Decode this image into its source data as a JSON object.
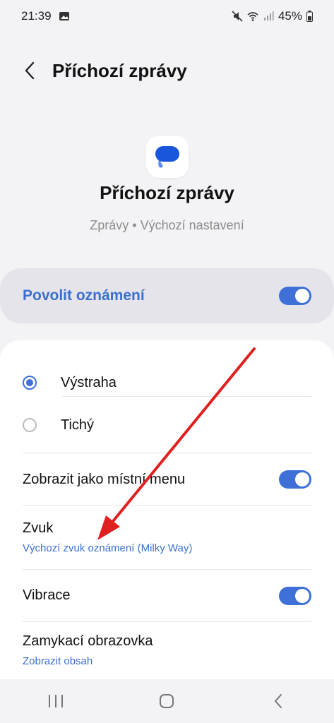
{
  "status_bar": {
    "time": "21:39",
    "battery": "45%"
  },
  "header": {
    "title": "Příchozí zprávy"
  },
  "channel": {
    "title": "Příchozí zprávy",
    "subtitle": "Zprávy • Výchozí nastavení"
  },
  "allow": {
    "label": "Povolit oznámení",
    "enabled": true
  },
  "alert_options": [
    {
      "label": "Výstraha",
      "selected": true
    },
    {
      "label": "Tichý",
      "selected": false
    }
  ],
  "settings": {
    "popup": {
      "label": "Zobrazit jako místní menu",
      "enabled": true
    },
    "sound": {
      "label": "Zvuk",
      "value": "Výchozí zvuk oznámení (Milky Way)"
    },
    "vibration": {
      "label": "Vibrace",
      "enabled": true
    },
    "lock_screen": {
      "label": "Zamykací obrazovka",
      "value": "Zobrazit obsah"
    }
  },
  "colors": {
    "accent": "#3e70d8",
    "annotation_arrow": "#e02020"
  }
}
